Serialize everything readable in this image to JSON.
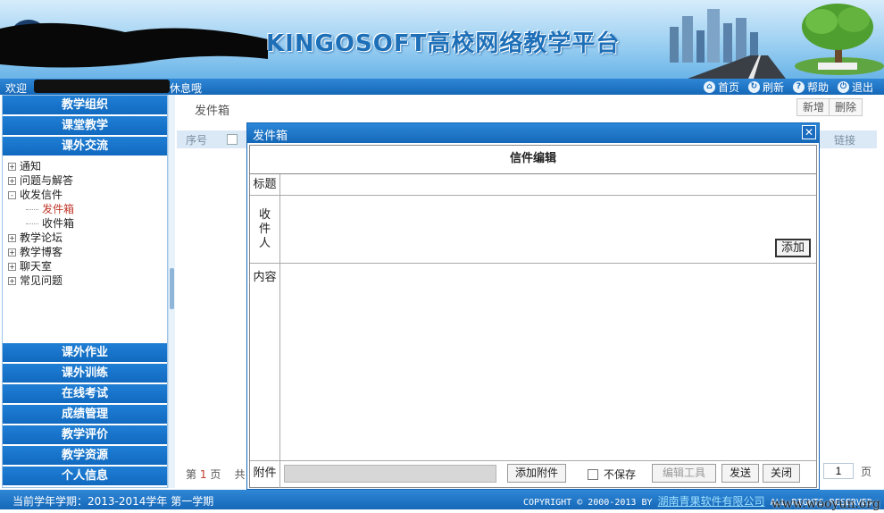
{
  "banner": {
    "title": "KINGOSOFT高校网络教学平台"
  },
  "topbar": {
    "welcome_prefix": "欢迎",
    "welcome_suffix": "休息哦",
    "links": [
      {
        "label": "首页",
        "icon": "home-icon"
      },
      {
        "label": "刷新",
        "icon": "refresh-icon"
      },
      {
        "label": "帮助",
        "icon": "help-icon"
      },
      {
        "label": "退出",
        "icon": "logout-icon"
      }
    ]
  },
  "sidebar": {
    "top_nav": [
      "教学组织",
      "课堂教学",
      "课外交流"
    ],
    "tree": [
      {
        "label": "通知",
        "state": "+"
      },
      {
        "label": "问题与解答",
        "state": "+"
      },
      {
        "label": "收发信件",
        "state": "-"
      },
      {
        "label": "发件箱",
        "child": true,
        "active": true
      },
      {
        "label": "收件箱",
        "child": true
      },
      {
        "label": "教学论坛",
        "state": "+"
      },
      {
        "label": "教学博客",
        "state": "+"
      },
      {
        "label": "聊天室",
        "state": "+"
      },
      {
        "label": "常见问题",
        "state": "+"
      }
    ],
    "bottom_nav": [
      "课外作业",
      "课外训练",
      "在线考试",
      "成绩管理",
      "教学评价",
      "教学资源",
      "个人信息"
    ]
  },
  "main": {
    "title": "发件箱",
    "new_label": "新增",
    "delete_label": "删除",
    "col_index": "序号",
    "col_link": "链接",
    "pager_prefix": "第",
    "pager_page": "1",
    "pager_suffix": "页",
    "pager_total": "共",
    "page_value": "1",
    "page_suffix": "页"
  },
  "dialog": {
    "title": "发件箱",
    "close": "✕",
    "form_title": "信件编辑",
    "label_title": "标题",
    "label_recipient": "收件人",
    "add_label": "添加",
    "label_content": "内容",
    "label_attach": "附件",
    "add_attach_label": "添加附件",
    "nosave_label": "不保存",
    "edit_tool_label": "编辑工具",
    "send_label": "发送",
    "close_label": "关闭"
  },
  "footer": {
    "term": "当前学年学期：2013-2014学年 第一学期",
    "copyright_prefix": "COPYRIGHT © 2000-2013 BY",
    "company": "湖南青果软件有限公司",
    "copyright_suffix": "ALL RIGHTS RESERVED",
    "watermark": "www.wooyun.org"
  }
}
